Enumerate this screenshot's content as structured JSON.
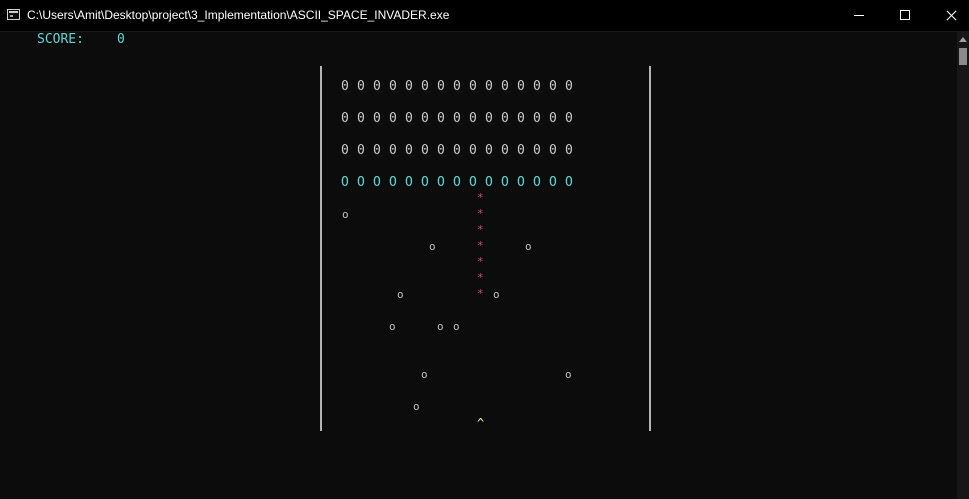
{
  "window": {
    "title": "C:\\Users\\Amit\\Desktop\\project\\3_Implementation\\ASCII_SPACE_INVADER.exe"
  },
  "hud": {
    "score_label": "SCORE:",
    "score_value": "0"
  },
  "game": {
    "invader_glyph": "0",
    "front_row_glyph": "O",
    "enemy_bullet_glyph": "o",
    "player_shot_glyph": "*",
    "player_glyph": "^",
    "invaders_per_row": 15,
    "invader_rows": 4,
    "enemy_bullet_count": 13,
    "player_shot_count": 7,
    "colors": {
      "background": "#0c0c0c",
      "text": "#cccccc",
      "score": "#61d6d6",
      "front_row": "#61d6d6",
      "shot": "#e74856",
      "player": "#f9f1a5"
    }
  }
}
